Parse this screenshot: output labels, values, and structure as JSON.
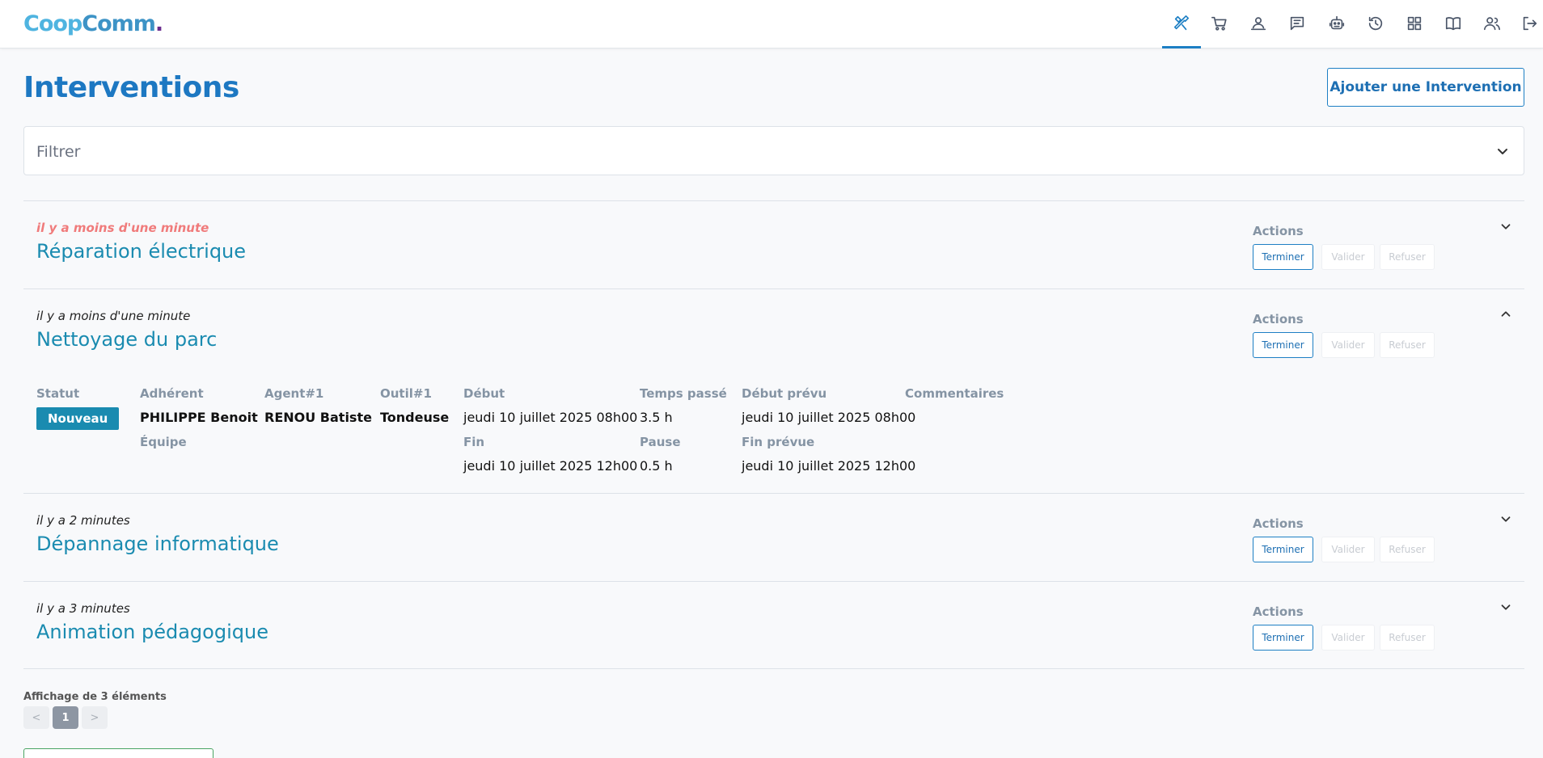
{
  "header": {
    "logo": {
      "part1": "Coop",
      "part2": "C",
      "part3": "omm",
      "dot": "."
    },
    "icons": [
      "tools-icon",
      "cart-icon",
      "user-desk-icon",
      "chat-icon",
      "robot-icon",
      "history-icon",
      "grid-icon",
      "book-icon",
      "users-icon",
      "logout-icon"
    ]
  },
  "page": {
    "title": "Interventions",
    "add_button": "Ajouter une Intervention"
  },
  "filter": {
    "label": "Filtrer"
  },
  "interventions": [
    {
      "time": "il y a moins d'une minute",
      "title": "Réparation électrique",
      "actions_label": "Actions",
      "buttons": {
        "terminer": "Terminer",
        "valider": "Valider",
        "refuser": "Refuser"
      },
      "expanded": false
    },
    {
      "time": "il y a moins d'une minute",
      "title": "Nettoyage du parc",
      "actions_label": "Actions",
      "buttons": {
        "terminer": "Terminer",
        "valider": "Valider",
        "refuser": "Refuser"
      },
      "expanded": true,
      "details": {
        "statut_label": "Statut",
        "statut": "Nouveau",
        "adherent_label": "Adhérent",
        "adherent": "PHILIPPE Benoit",
        "equipe_label": "Équipe",
        "agent_label": "Agent#1",
        "agent": "RENOU Batiste",
        "outil_label": "Outil#1",
        "outil": "Tondeuse",
        "debut_label": "Début",
        "debut": "jeudi 10 juillet 2025 08h00",
        "fin_label": "Fin",
        "fin": "jeudi 10 juillet 2025 12h00",
        "temps_label": "Temps passé",
        "temps": "3.5 h",
        "pause_label": "Pause",
        "pause": "0.5 h",
        "debut_prevu_label": "Début prévu",
        "debut_prevu": "jeudi 10 juillet 2025 08h00",
        "fin_prevue_label": "Fin prévue",
        "fin_prevue": "jeudi 10 juillet 2025 12h00",
        "commentaires_label": "Commentaires"
      }
    },
    {
      "time": "il y a 2 minutes",
      "title": "Dépannage informatique",
      "actions_label": "Actions",
      "buttons": {
        "terminer": "Terminer",
        "valider": "Valider",
        "refuser": "Refuser"
      },
      "expanded": false
    },
    {
      "time": "il y a 3 minutes",
      "title": "Animation pédagogique",
      "actions_label": "Actions",
      "buttons": {
        "terminer": "Terminer",
        "valider": "Valider",
        "refuser": "Refuser"
      },
      "expanded": false
    }
  ],
  "footer": {
    "info": "Affichage de 3 éléments",
    "pagination": {
      "prev": "<",
      "current": "1",
      "next": ">"
    }
  },
  "colors": {
    "primary": "#1d7fc4",
    "title_teal": "#1a8bb0",
    "recent": "#f07b7b"
  }
}
